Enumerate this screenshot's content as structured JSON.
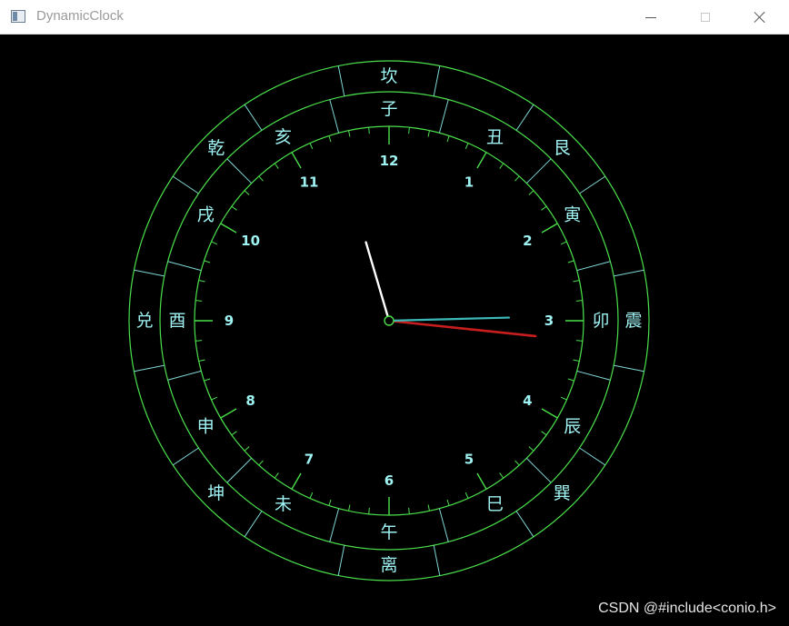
{
  "window": {
    "title": "DynamicClock",
    "controls": {
      "minimize": "—",
      "maximize": "□",
      "close": "✕"
    }
  },
  "clock": {
    "hour_numbers": [
      "12",
      "1",
      "2",
      "3",
      "4",
      "5",
      "6",
      "7",
      "8",
      "9",
      "10",
      "11"
    ],
    "branches": [
      "子",
      "丑",
      "寅",
      "卯",
      "辰",
      "巳",
      "午",
      "未",
      "申",
      "酉",
      "戌",
      "亥"
    ],
    "trigrams": [
      {
        "label": "坎",
        "angle": 0
      },
      {
        "label": "艮",
        "angle": 45
      },
      {
        "label": "震",
        "angle": 90
      },
      {
        "label": "巽",
        "angle": 135
      },
      {
        "label": "离",
        "angle": 180
      },
      {
        "label": "坤",
        "angle": 225
      },
      {
        "label": "兑",
        "angle": 270
      },
      {
        "label": "乾",
        "angle": 315
      }
    ],
    "time": {
      "hour": 2,
      "minute": 57,
      "second": 16
    },
    "colors": {
      "ring": "#4be04b",
      "divider": "#7fd6d6",
      "text": "#9ff3f3",
      "hour_hand": "#ffffff",
      "minute_hand": "#3db8b8",
      "second_hand": "#c81e1e"
    }
  },
  "watermark": "CSDN @#include<conio.h>"
}
